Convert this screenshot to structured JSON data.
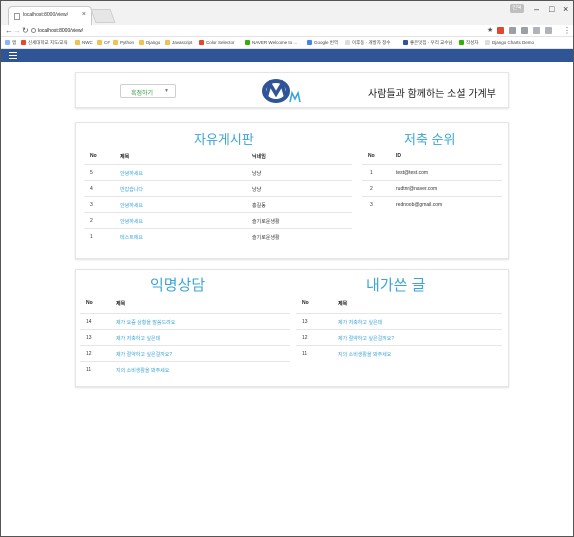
{
  "browser": {
    "tab_title": "localhost:8000/view/",
    "url": "localhost:8000/view/",
    "user_badge": "인덕",
    "bookmarks": [
      "앱",
      "신세대학교 지도/교육",
      "NWC",
      "C#",
      "Python",
      "Django",
      "Javascript",
      "Color Selector",
      "NAVER Welcome to ...",
      "Google 번역",
      "이후동 · 개발자 정수",
      "좋은맛집 · 우리 교수님",
      "작성자",
      "Django Charts Demo"
    ]
  },
  "header": {
    "select_label": "흑점하기",
    "tagline": "사람들과 함께하는 소셜 가계부"
  },
  "board": {
    "title": "자유게시판",
    "col_no": "No",
    "col_title": "제목",
    "col_author": "닉네임",
    "rows": [
      {
        "no": "5",
        "title": "안녕하세요",
        "author": "냥냥"
      },
      {
        "no": "4",
        "title": "반갑습니다",
        "author": "냥냥"
      },
      {
        "no": "3",
        "title": "안녕하세요",
        "author": "홍길동"
      },
      {
        "no": "2",
        "title": "안녕하세요",
        "author": "슬기로운생활"
      },
      {
        "no": "1",
        "title": "테스트에요",
        "author": "슬기로운생활"
      }
    ]
  },
  "ranking": {
    "title": "저축 순위",
    "col_no": "No",
    "col_id": "ID",
    "rows": [
      {
        "no": "1",
        "id": "test@test.com"
      },
      {
        "no": "2",
        "id": "rudtnr@naver.com"
      },
      {
        "no": "3",
        "id": "rednoob@gmail.com"
      }
    ]
  },
  "counsel": {
    "title": "익명상담",
    "col_no": "No",
    "col_title": "제목",
    "rows": [
      {
        "no": "14",
        "title": "제가 요즘 상황을 말씀드려요"
      },
      {
        "no": "13",
        "title": "제가 저축하고 싶은데"
      },
      {
        "no": "12",
        "title": "제가 절약하고 싶은걸까요?"
      },
      {
        "no": "11",
        "title": "지의 소비생활을 봐주세요"
      }
    ]
  },
  "mine": {
    "title": "내가쓴 글",
    "col_no": "No",
    "col_title": "제목",
    "rows": [
      {
        "no": "13",
        "title": "제가 저축하고 싶은데"
      },
      {
        "no": "12",
        "title": "제가 절약하고 싶은걸까요?"
      },
      {
        "no": "11",
        "title": "지의 소비생활을 봐주세요"
      }
    ]
  },
  "colors": {
    "navbar": "#2f5597",
    "accent": "#3ca5d7",
    "select_text": "#2e9a3e"
  }
}
